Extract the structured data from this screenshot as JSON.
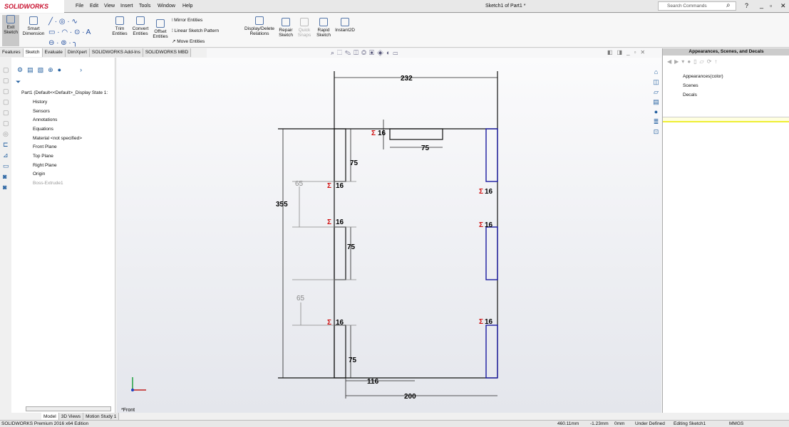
{
  "app": {
    "logo": "SOLIDWORKS",
    "title": "Sketch1 of Part1 *",
    "search_placeholder": "Search Commands"
  },
  "menu": [
    "File",
    "Edit",
    "View",
    "Insert",
    "Tools",
    "Window",
    "Help"
  ],
  "toolbar": {
    "exit_sketch": "Exit Sketch",
    "smart_dimension": "Smart Dimension",
    "trim": "Trim Entities",
    "convert": "Convert Entities",
    "offset": "Offset Entities",
    "mirror": "Mirror Entities",
    "linear_pattern": "Linear Sketch Pattern",
    "move": "Move Entities",
    "relations": "Display/Delete Relations",
    "repair": "Repair Sketch",
    "quick_snaps": "Quick Snaps",
    "rapid": "Rapid Sketch",
    "instant2d": "Instant2D"
  },
  "tabs": [
    "Features",
    "Sketch",
    "Evaluate",
    "DimXpert",
    "SOLIDWORKS Add-Ins",
    "SOLIDWORKS MBD"
  ],
  "tree": {
    "root": "Part1  (Default<<Default>_Display State 1:",
    "items": [
      "History",
      "Sensors",
      "Annotations",
      "Equations",
      "Material <not specified>",
      "Front Plane",
      "Top Plane",
      "Right Plane",
      "Origin",
      "Boss-Extrude1"
    ]
  },
  "taskpane": {
    "title": "Appearances, Scenes, and Decals",
    "items": [
      "Appearances(color)",
      "Scenes",
      "Decals"
    ]
  },
  "sketch": {
    "dims": {
      "width": "232",
      "height": "355",
      "d200": "200",
      "d116": "116",
      "d75": "75",
      "d65": "65",
      "d16": "16"
    },
    "view_label": "*Front"
  },
  "bottom_tabs": [
    "Model",
    "3D Views",
    "Motion Study 1"
  ],
  "status": {
    "edition": "SOLIDWORKS Premium 2016 x64 Edition",
    "x": "460.11mm",
    "y": "-1.23mm",
    "z": "0mm",
    "state": "Under Defined",
    "mode": "Editing Sketch1",
    "units": "MMGS"
  },
  "colors": {
    "selected": "#1a1aa0",
    "relation": "#d01010"
  }
}
